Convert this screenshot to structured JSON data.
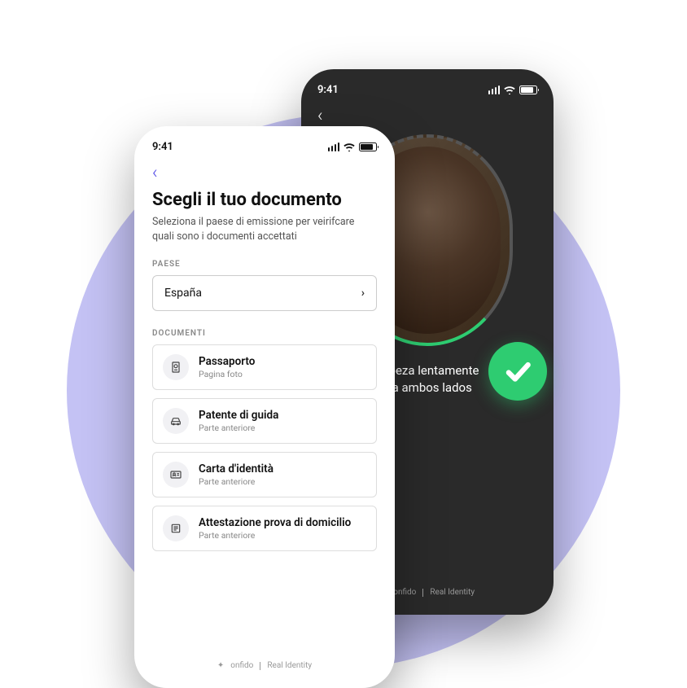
{
  "status_time": "9:41",
  "dark_phone": {
    "instruction_line1": "cabeza lentamente",
    "instruction_line2": "cia ambos lados",
    "brand": "onfido",
    "brand_suffix": "Real Identity"
  },
  "light_phone": {
    "title": "Scegli il tuo documento",
    "subtitle": "Seleziona il paese di emissione per veirifcare quali sono i documenti accettati",
    "country_label": "PAESE",
    "country_value": "España",
    "docs_label": "DOCUMENTI",
    "docs": [
      {
        "title": "Passaporto",
        "sub": "Pagina foto",
        "icon": "passport-icon"
      },
      {
        "title": "Patente di guida",
        "sub": "Parte anteriore",
        "icon": "car-icon"
      },
      {
        "title": "Carta d'identità",
        "sub": "Parte anteriore",
        "icon": "id-card-icon"
      },
      {
        "title": "Attestazione prova di domicilio",
        "sub": "Parte anteriore",
        "icon": "home-doc-icon"
      }
    ],
    "brand": "onfido",
    "brand_suffix": "Real Identity"
  }
}
